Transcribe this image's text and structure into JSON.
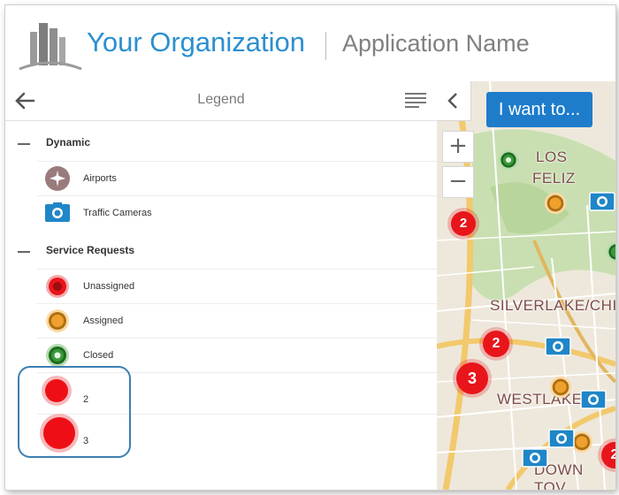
{
  "header": {
    "org_name": "Your Organization",
    "app_name": "Application Name"
  },
  "legend": {
    "title": "Legend",
    "groups": [
      {
        "name": "Dynamic",
        "items": [
          {
            "label": "Airports",
            "icon": "airport-icon"
          },
          {
            "label": "Traffic Cameras",
            "icon": "camera-icon"
          }
        ]
      },
      {
        "name": "Service Requests",
        "items": [
          {
            "label": "Unassigned",
            "icon": "red-circle-icon"
          },
          {
            "label": "Assigned",
            "icon": "orange-circle-icon"
          },
          {
            "label": "Closed",
            "icon": "green-circle-icon"
          }
        ]
      }
    ],
    "clusters": [
      {
        "label": "2",
        "icon": "cluster-small-icon"
      },
      {
        "label": "3",
        "icon": "cluster-large-icon"
      }
    ]
  },
  "map": {
    "i_want_to": "I want to...",
    "zoom_in": "+",
    "zoom_out": "−",
    "places": [
      "LOS",
      "FELIZ",
      "SILVERLAKE/CHI",
      "WESTLAKE",
      "DOWN TOV"
    ],
    "cluster_counts": [
      "2",
      "2",
      "3",
      "2"
    ]
  },
  "colors": {
    "accent": "#2b8fd0",
    "button": "#1e7ccb",
    "unassigned": "#e8151b",
    "assigned": "#f0a12d",
    "closed": "#3a9a3a"
  }
}
